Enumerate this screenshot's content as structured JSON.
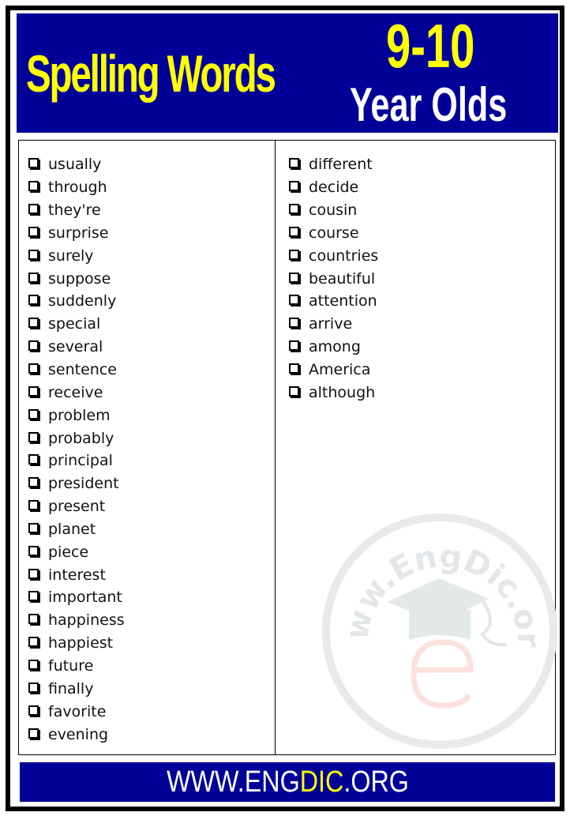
{
  "header": {
    "title": "Spelling Words",
    "age_range": "9-10",
    "subtitle": "Year Olds"
  },
  "colors": {
    "header_bg": "#000099",
    "title_yellow": "#ffff00",
    "subtitle_white": "#ffffff",
    "frame": "#000000"
  },
  "word_list": {
    "left_column": [
      "usually",
      "through",
      "they're",
      "surprise",
      "surely",
      "suppose",
      "suddenly",
      "special",
      "several",
      "sentence",
      "receive",
      "problem",
      "probably",
      "principal",
      "president",
      "present",
      "planet",
      "piece",
      "interest",
      "important",
      "happiness",
      "happiest",
      "future",
      "finally",
      "favorite",
      "evening"
    ],
    "right_column": [
      "different",
      "decide",
      "cousin",
      "course",
      "countries",
      "beautiful",
      "attention",
      "arrive",
      "among",
      "America",
      "although"
    ]
  },
  "watermark": {
    "text": "www.EngDic.org",
    "icon": "graduation-cap-e-logo"
  },
  "footer": {
    "prefix": "WWW.ENG",
    "accent": "DIC",
    "suffix": ".ORG"
  }
}
